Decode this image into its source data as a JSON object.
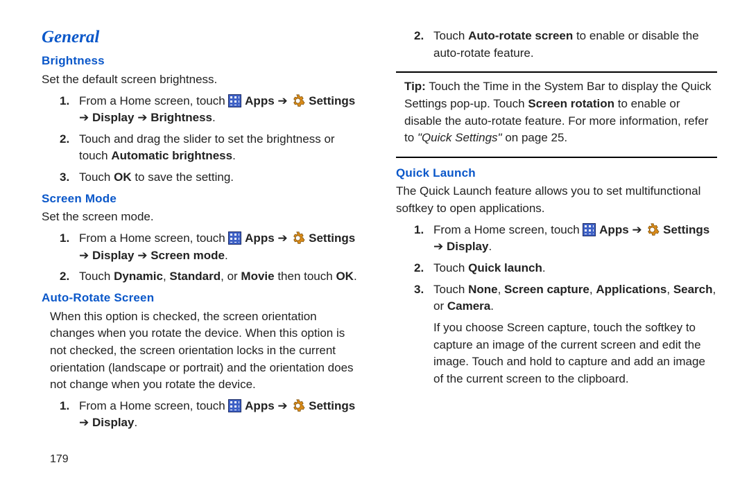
{
  "headings": {
    "general": "General",
    "brightness": "Brightness",
    "screen_mode": "Screen Mode",
    "auto_rotate": "Auto-Rotate Screen",
    "quick_launch": "Quick Launch"
  },
  "text": {
    "brightness_intro": "Set the default screen brightness.",
    "screen_mode_intro": "Set the screen mode.",
    "auto_rotate_intro": "When this option is checked, the screen orientation changes when you rotate the device. When this option is not checked, the screen orientation locks in the current orientation (landscape or portrait) and the orientation does not change when you rotate the device.",
    "quick_launch_intro": "The Quick Launch feature allows you to set multifunctional softkey to open applications.",
    "tip_label": "Tip:",
    "tip_body1": " Touch the Time in the System Bar to display the Quick Settings pop-up. Touch ",
    "tip_screen_rotation": "Screen rotation",
    "tip_body2": " to enable or disable the auto-rotate feature. For more information, refer to ",
    "tip_ref": "\"Quick Settings\"",
    "tip_page": " on page 25.",
    "from_home": "From a Home screen, touch ",
    "apps": "Apps",
    "settings": "Settings",
    "display": "Display",
    "brightness_path_end": "Brightness",
    "screen_mode_path_end": "Screen mode",
    "brightness_step2a": "Touch and drag the slider to set the brightness or touch ",
    "automatic_brightness": "Automatic brightness",
    "brightness_step3a": "Touch ",
    "ok": "OK",
    "brightness_step3b": " to save the setting.",
    "screen_mode_step2a": "Touch ",
    "dynamic": "Dynamic",
    "standard": "Standard",
    "or": " or ",
    "comma_sep": ", ",
    "movie": "Movie",
    "then_touch": " then touch ",
    "auto_rotate_step2a": "Touch ",
    "auto_rotate_screen_bold": "Auto-rotate screen",
    "auto_rotate_step2b": " to enable or disable the auto-rotate feature.",
    "ql_step2a": "Touch ",
    "quick_launch_bold": "Quick launch",
    "ql_step3a": "Touch ",
    "none": "None",
    "screen_capture": "Screen capture",
    "applications": "Applications",
    "search": "Search",
    "camera": "Camera",
    "ql_followup": "If you choose Screen capture, touch the softkey to capture an image of the current screen and edit the image. Touch and hold to capture and add an image of the current screen to the clipboard.",
    "page_number": "179",
    "period": ".",
    "arrow": "➔"
  }
}
